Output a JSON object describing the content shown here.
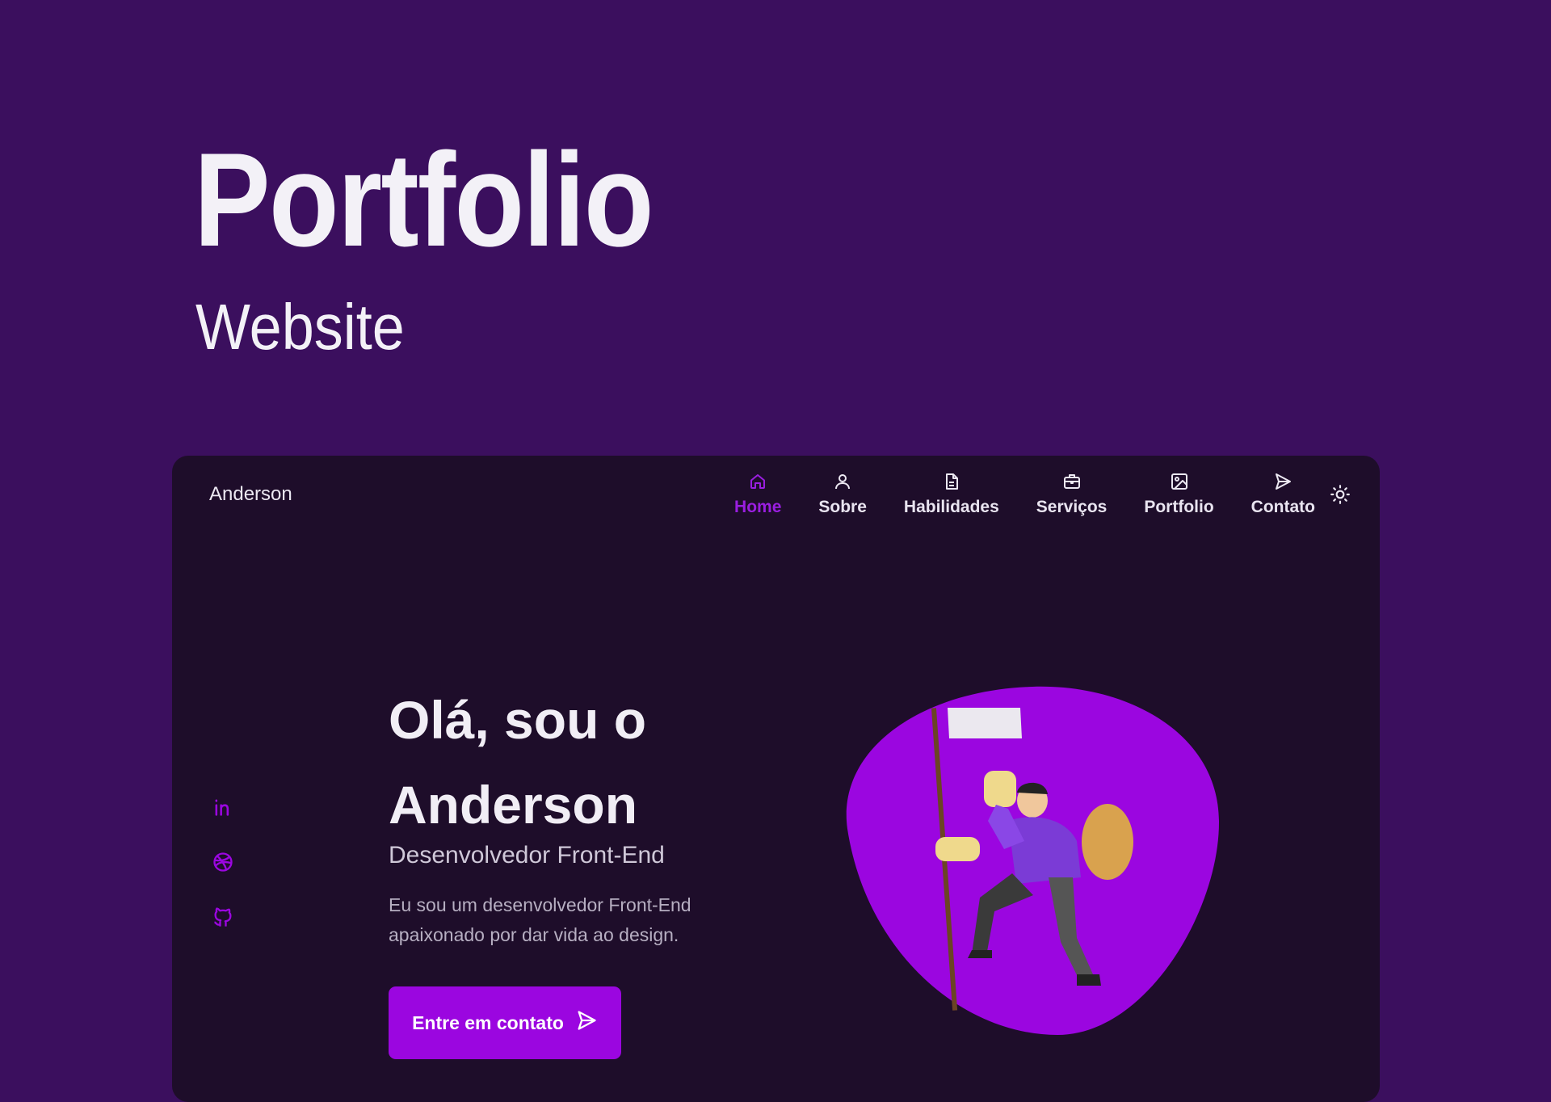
{
  "hero": {
    "title": "Portfolio",
    "subtitle": "Website"
  },
  "site": {
    "brand": "Anderson",
    "nav": [
      {
        "label": "Home",
        "icon": "home-icon",
        "active": true
      },
      {
        "label": "Sobre",
        "icon": "user-icon",
        "active": false
      },
      {
        "label": "Habilidades",
        "icon": "file-icon",
        "active": false
      },
      {
        "label": "Serviços",
        "icon": "briefcase-icon",
        "active": false
      },
      {
        "label": "Portfolio",
        "icon": "image-icon",
        "active": false
      },
      {
        "label": "Contato",
        "icon": "send-icon",
        "active": false
      }
    ],
    "theme_toggle_icon": "sun-icon",
    "socials": [
      "linkedin-icon",
      "dribbble-icon",
      "github-icon"
    ],
    "greeting_line1": "Olá, sou o",
    "greeting_line2": "Anderson",
    "role": "Desenvolvedor Front-End",
    "description": "Eu sou um desenvolvedor Front-End apaixonado por dar vida ao design.",
    "cta_label": "Entre em contato"
  },
  "colors": {
    "page_bg": "#3b0f5e",
    "card_bg": "#1e0d2a",
    "accent": "#9b06e0",
    "text_light": "#f1eef5"
  }
}
